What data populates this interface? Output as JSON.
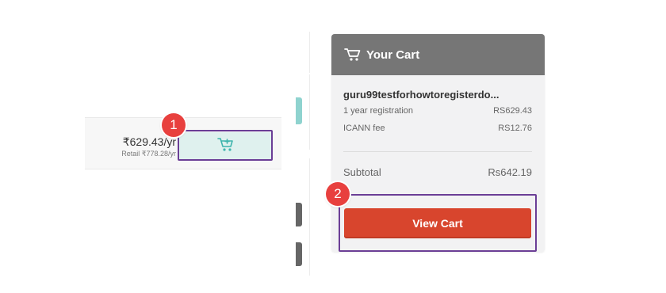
{
  "listing": {
    "price": "₹629.43/yr",
    "retail": "Retail ₹778.28/yr",
    "add_to_cart_icon": "cart-plus-icon"
  },
  "cart": {
    "title": "Your Cart",
    "icon": "cart-icon",
    "domain": "guru99testforhowtoregisterdo...",
    "lines": [
      {
        "label": "1 year registration",
        "amount": "RS629.43"
      },
      {
        "label": "ICANN fee",
        "amount": "RS12.76"
      }
    ],
    "subtotal_label": "Subtotal",
    "subtotal_amount": "Rs642.19",
    "view_cart_label": "View Cart"
  },
  "annotations": {
    "step1": "1",
    "step2": "2"
  },
  "colors": {
    "cart_header": "#767676",
    "view_cart_button": "#d8452d",
    "add_cart_button": "#dff1ee",
    "highlight_outline": "#6b3e96",
    "badge": "#e8403e"
  }
}
